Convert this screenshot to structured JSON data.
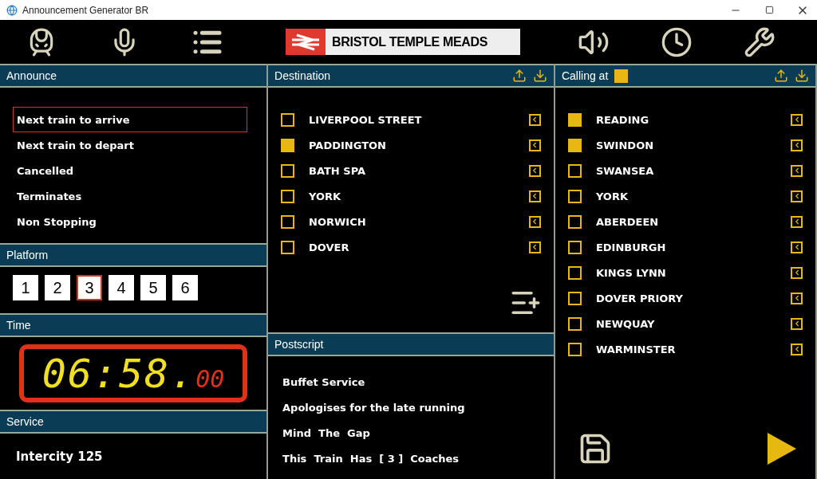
{
  "window": {
    "title": "Announcement Generator BR"
  },
  "station": "BRISTOL TEMPLE MEADS",
  "announce": {
    "title": "Announce",
    "options": [
      {
        "label": "Next train to arrive",
        "selected": true
      },
      {
        "label": "Next train to depart",
        "selected": false
      },
      {
        "label": "Cancelled",
        "selected": false
      },
      {
        "label": "Terminates",
        "selected": false
      },
      {
        "label": "Non Stopping",
        "selected": false
      }
    ]
  },
  "platform": {
    "title": "Platform",
    "numbers": [
      {
        "label": "1",
        "selected": false
      },
      {
        "label": "2",
        "selected": false
      },
      {
        "label": "3",
        "selected": true
      },
      {
        "label": "4",
        "selected": false
      },
      {
        "label": "5",
        "selected": false
      },
      {
        "label": "6",
        "selected": false
      }
    ]
  },
  "time": {
    "title": "Time",
    "clock": "06:58.",
    "seconds": "00"
  },
  "service": {
    "title": "Service",
    "value": "Intercity 125"
  },
  "destination": {
    "title": "Destination",
    "stations": [
      {
        "name": "LIVERPOOL STREET",
        "checked": false
      },
      {
        "name": "PADDINGTON",
        "checked": true
      },
      {
        "name": "BATH SPA",
        "checked": false
      },
      {
        "name": "YORK",
        "checked": false
      },
      {
        "name": "NORWICH",
        "checked": false
      },
      {
        "name": "DOVER",
        "checked": false
      }
    ]
  },
  "postscript": {
    "title": "Postscript",
    "items": [
      "Buffet Service",
      "Apologises for the late running",
      "Mind  The  Gap",
      "This  Train  Has  [ 3 ]  Coaches"
    ]
  },
  "calling_at": {
    "title": "Calling at",
    "select_all_checked": true,
    "stations": [
      {
        "name": "READING",
        "checked": true
      },
      {
        "name": "SWINDON",
        "checked": true
      },
      {
        "name": "SWANSEA",
        "checked": false
      },
      {
        "name": "YORK",
        "checked": false
      },
      {
        "name": "ABERDEEN",
        "checked": false
      },
      {
        "name": "EDINBURGH",
        "checked": false
      },
      {
        "name": "KINGS LYNN",
        "checked": false
      },
      {
        "name": "DOVER PRIORY",
        "checked": false
      },
      {
        "name": "NEWQUAY",
        "checked": false
      },
      {
        "name": "WARMINSTER",
        "checked": false
      }
    ]
  }
}
